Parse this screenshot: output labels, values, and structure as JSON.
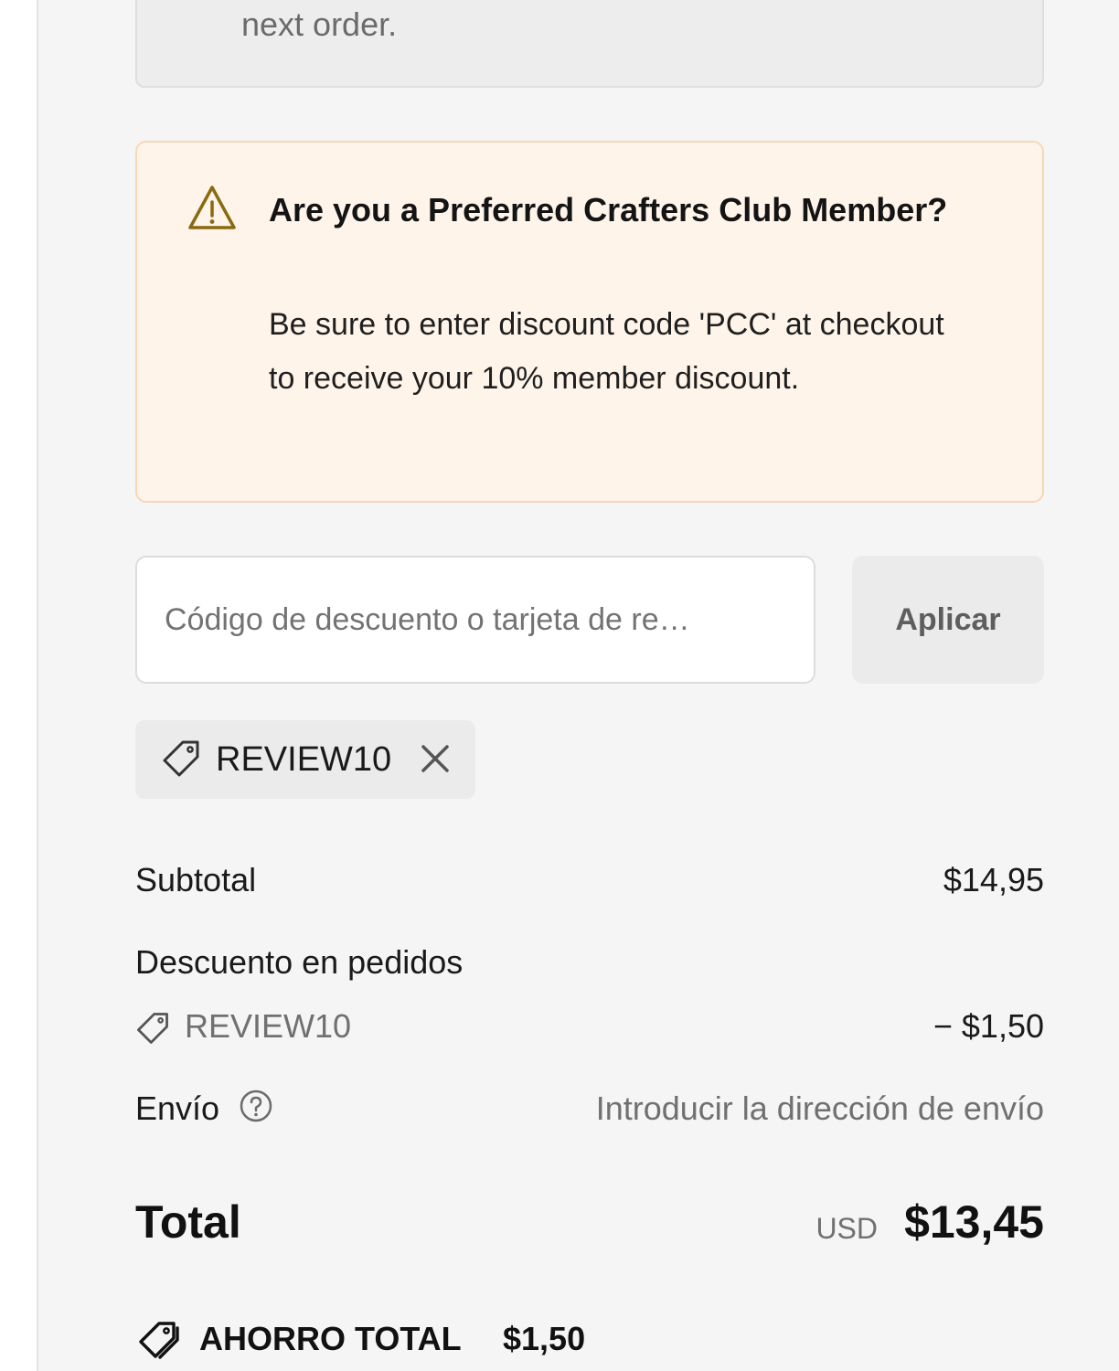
{
  "previous_notice": {
    "text_tail": "next order."
  },
  "pcc_notice": {
    "icon": "warning-icon",
    "title": "Are you a Preferred Crafters Club Member?",
    "body": "Be sure to enter discount code 'PCC' at checkout to receive your 10% member discount."
  },
  "discount_form": {
    "placeholder": "Código de descuento o tarjeta de re…",
    "value": "",
    "apply_label": "Aplicar"
  },
  "applied_code_chip": {
    "code": "REVIEW10",
    "tag_icon": "tag-icon",
    "remove_icon": "close-icon"
  },
  "summary": {
    "subtotal_label": "Subtotal",
    "subtotal_value": "$14,95",
    "order_discount_label": "Descuento en pedidos",
    "order_discount_code": "REVIEW10",
    "order_discount_value": "− $1,50",
    "shipping_label": "Envío",
    "shipping_value": "Introducir la dirección de envío",
    "total_label": "Total",
    "total_currency": "USD",
    "total_value": "$13,45",
    "savings_label": "AHORRO TOTAL",
    "savings_value": "$1,50"
  },
  "colors": {
    "panel_bg": "#f5f5f5",
    "notice_bg": "#fff4ea",
    "notice_border": "#f7d7b4",
    "warning_icon": "#8a6a10",
    "muted_text": "#707070"
  }
}
